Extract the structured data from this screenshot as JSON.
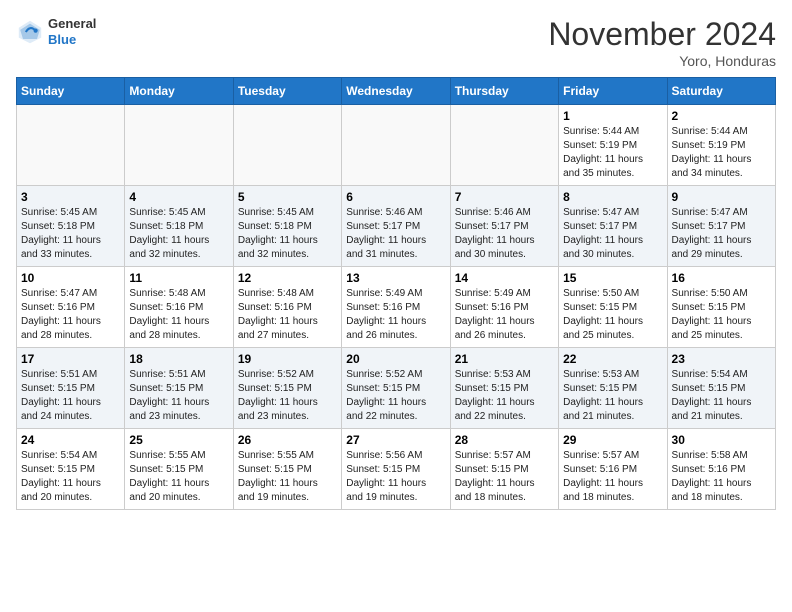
{
  "header": {
    "logo_line1": "General",
    "logo_line2": "Blue",
    "month": "November 2024",
    "location": "Yoro, Honduras"
  },
  "weekdays": [
    "Sunday",
    "Monday",
    "Tuesday",
    "Wednesday",
    "Thursday",
    "Friday",
    "Saturday"
  ],
  "weeks": [
    [
      {
        "day": "",
        "info": ""
      },
      {
        "day": "",
        "info": ""
      },
      {
        "day": "",
        "info": ""
      },
      {
        "day": "",
        "info": ""
      },
      {
        "day": "",
        "info": ""
      },
      {
        "day": "1",
        "info": "Sunrise: 5:44 AM\nSunset: 5:19 PM\nDaylight: 11 hours\nand 35 minutes."
      },
      {
        "day": "2",
        "info": "Sunrise: 5:44 AM\nSunset: 5:19 PM\nDaylight: 11 hours\nand 34 minutes."
      }
    ],
    [
      {
        "day": "3",
        "info": "Sunrise: 5:45 AM\nSunset: 5:18 PM\nDaylight: 11 hours\nand 33 minutes."
      },
      {
        "day": "4",
        "info": "Sunrise: 5:45 AM\nSunset: 5:18 PM\nDaylight: 11 hours\nand 32 minutes."
      },
      {
        "day": "5",
        "info": "Sunrise: 5:45 AM\nSunset: 5:18 PM\nDaylight: 11 hours\nand 32 minutes."
      },
      {
        "day": "6",
        "info": "Sunrise: 5:46 AM\nSunset: 5:17 PM\nDaylight: 11 hours\nand 31 minutes."
      },
      {
        "day": "7",
        "info": "Sunrise: 5:46 AM\nSunset: 5:17 PM\nDaylight: 11 hours\nand 30 minutes."
      },
      {
        "day": "8",
        "info": "Sunrise: 5:47 AM\nSunset: 5:17 PM\nDaylight: 11 hours\nand 30 minutes."
      },
      {
        "day": "9",
        "info": "Sunrise: 5:47 AM\nSunset: 5:17 PM\nDaylight: 11 hours\nand 29 minutes."
      }
    ],
    [
      {
        "day": "10",
        "info": "Sunrise: 5:47 AM\nSunset: 5:16 PM\nDaylight: 11 hours\nand 28 minutes."
      },
      {
        "day": "11",
        "info": "Sunrise: 5:48 AM\nSunset: 5:16 PM\nDaylight: 11 hours\nand 28 minutes."
      },
      {
        "day": "12",
        "info": "Sunrise: 5:48 AM\nSunset: 5:16 PM\nDaylight: 11 hours\nand 27 minutes."
      },
      {
        "day": "13",
        "info": "Sunrise: 5:49 AM\nSunset: 5:16 PM\nDaylight: 11 hours\nand 26 minutes."
      },
      {
        "day": "14",
        "info": "Sunrise: 5:49 AM\nSunset: 5:16 PM\nDaylight: 11 hours\nand 26 minutes."
      },
      {
        "day": "15",
        "info": "Sunrise: 5:50 AM\nSunset: 5:15 PM\nDaylight: 11 hours\nand 25 minutes."
      },
      {
        "day": "16",
        "info": "Sunrise: 5:50 AM\nSunset: 5:15 PM\nDaylight: 11 hours\nand 25 minutes."
      }
    ],
    [
      {
        "day": "17",
        "info": "Sunrise: 5:51 AM\nSunset: 5:15 PM\nDaylight: 11 hours\nand 24 minutes."
      },
      {
        "day": "18",
        "info": "Sunrise: 5:51 AM\nSunset: 5:15 PM\nDaylight: 11 hours\nand 23 minutes."
      },
      {
        "day": "19",
        "info": "Sunrise: 5:52 AM\nSunset: 5:15 PM\nDaylight: 11 hours\nand 23 minutes."
      },
      {
        "day": "20",
        "info": "Sunrise: 5:52 AM\nSunset: 5:15 PM\nDaylight: 11 hours\nand 22 minutes."
      },
      {
        "day": "21",
        "info": "Sunrise: 5:53 AM\nSunset: 5:15 PM\nDaylight: 11 hours\nand 22 minutes."
      },
      {
        "day": "22",
        "info": "Sunrise: 5:53 AM\nSunset: 5:15 PM\nDaylight: 11 hours\nand 21 minutes."
      },
      {
        "day": "23",
        "info": "Sunrise: 5:54 AM\nSunset: 5:15 PM\nDaylight: 11 hours\nand 21 minutes."
      }
    ],
    [
      {
        "day": "24",
        "info": "Sunrise: 5:54 AM\nSunset: 5:15 PM\nDaylight: 11 hours\nand 20 minutes."
      },
      {
        "day": "25",
        "info": "Sunrise: 5:55 AM\nSunset: 5:15 PM\nDaylight: 11 hours\nand 20 minutes."
      },
      {
        "day": "26",
        "info": "Sunrise: 5:55 AM\nSunset: 5:15 PM\nDaylight: 11 hours\nand 19 minutes."
      },
      {
        "day": "27",
        "info": "Sunrise: 5:56 AM\nSunset: 5:15 PM\nDaylight: 11 hours\nand 19 minutes."
      },
      {
        "day": "28",
        "info": "Sunrise: 5:57 AM\nSunset: 5:15 PM\nDaylight: 11 hours\nand 18 minutes."
      },
      {
        "day": "29",
        "info": "Sunrise: 5:57 AM\nSunset: 5:16 PM\nDaylight: 11 hours\nand 18 minutes."
      },
      {
        "day": "30",
        "info": "Sunrise: 5:58 AM\nSunset: 5:16 PM\nDaylight: 11 hours\nand 18 minutes."
      }
    ]
  ]
}
